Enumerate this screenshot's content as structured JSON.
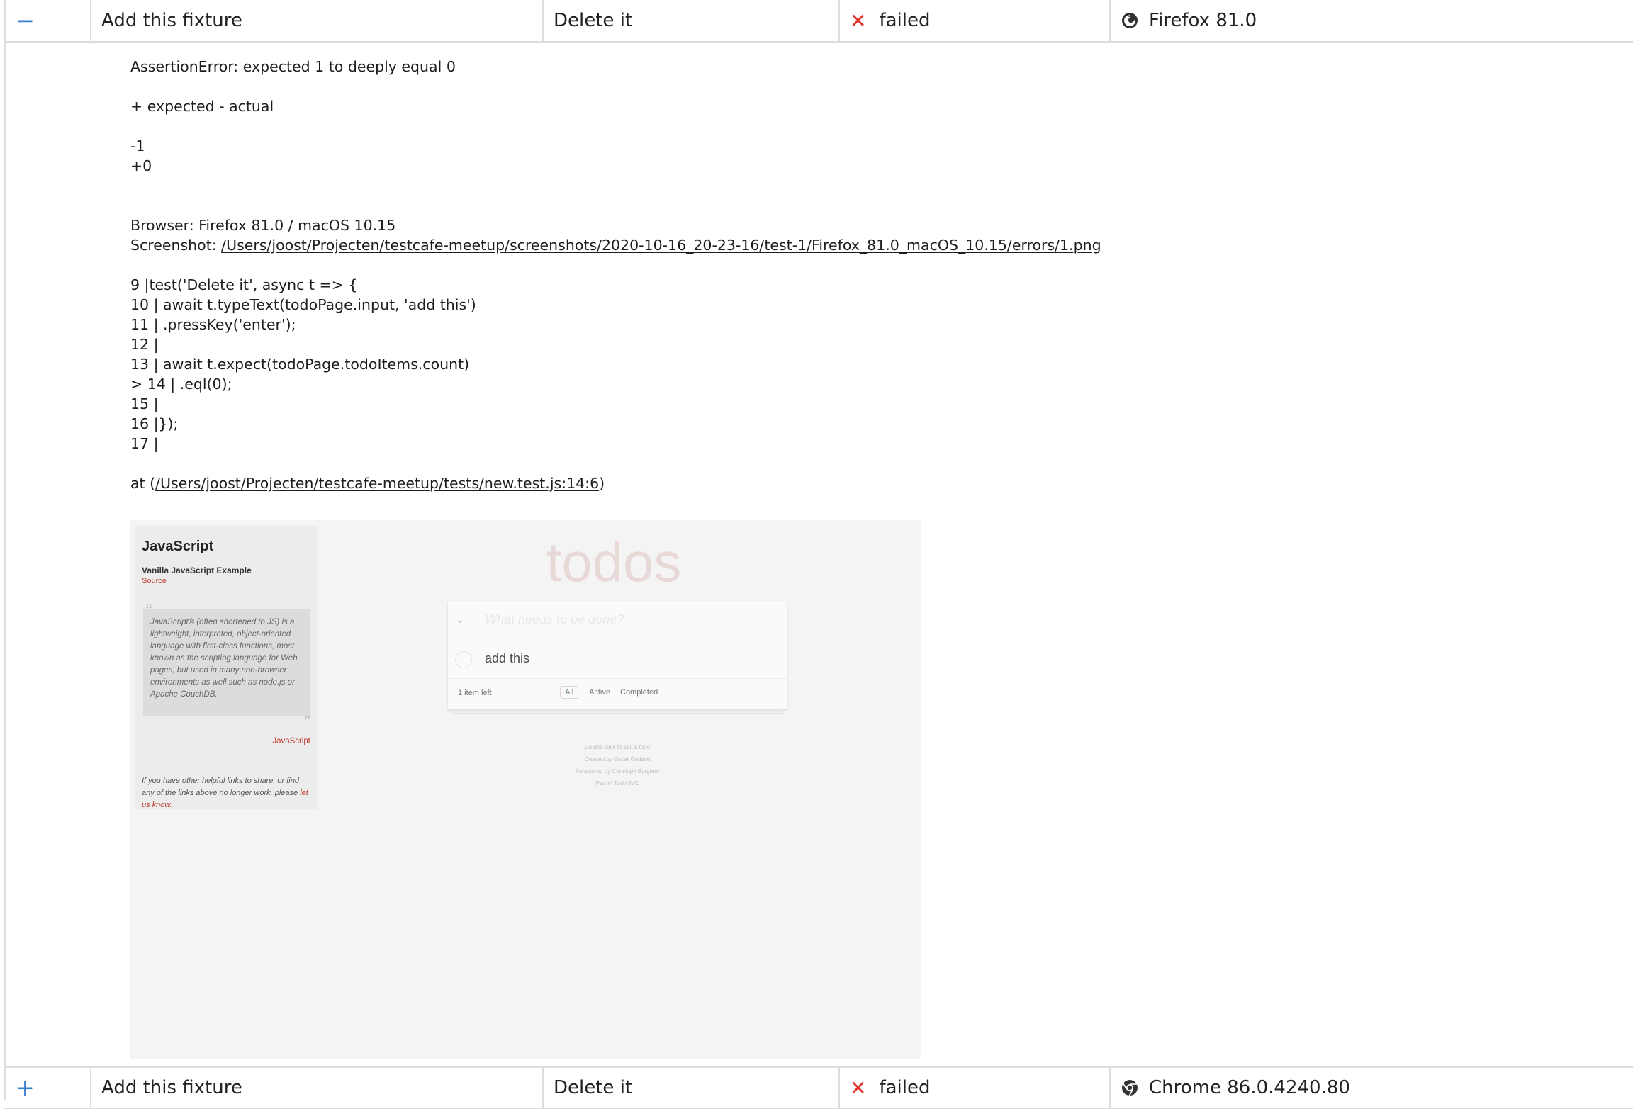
{
  "rows": [
    {
      "toggle": "−",
      "fixture": "Add this fixture",
      "test": "Delete it",
      "status_icon": "close-icon",
      "status": "failed",
      "browser_icon": "firefox-icon",
      "browser": "Firefox 81.0"
    },
    {
      "toggle": "+",
      "fixture": "Add this fixture",
      "test": "Delete it",
      "status_icon": "close-icon",
      "status": "failed",
      "browser_icon": "chrome-icon",
      "browser": "Chrome 86.0.4240.80"
    }
  ],
  "colors": {
    "accent": "#3b7fd1",
    "fail": "#e0342a",
    "border": "#dcdcdc"
  },
  "error": {
    "assertion": "AssertionError: expected 1 to deeply equal 0",
    "diff_header": "+ expected - actual",
    "diff_minus": "-1",
    "diff_plus": "+0",
    "browser_line": "Browser: Firefox 81.0 / macOS 10.15",
    "screenshot_label": "Screenshot: ",
    "screenshot_path": "/Users/joost/Projecten/testcafe-meetup/screenshots/2020-10-16_20-23-16/test-1/Firefox_81.0_macOS_10.15/errors/1.png",
    "code": [
      "9 |test('Delete it', async t => {",
      "10 | await t.typeText(todoPage.input, 'add this')",
      "11 | .pressKey('enter');",
      "12 |",
      "13 | await t.expect(todoPage.todoItems.count)",
      "> 14 | .eql(0);",
      "15 |",
      "16 |});",
      "17 |"
    ],
    "at_prefix": "at (",
    "at_path": "/Users/joost/Projecten/testcafe-meetup/tests/new.test.js:14:6",
    "at_suffix": ")"
  },
  "screenshot": {
    "sidebar": {
      "title": "JavaScript",
      "subtitle": "Vanilla JavaScript Example",
      "source": "Source",
      "quote": "JavaScript® (often shortened to JS) is a lightweight, interpreted, object-oriented language with first-class functions, most known as the scripting language for Web pages, but used in many non-browser environments as well such as node.js or Apache CouchDB.",
      "quote_cite": "JavaScript",
      "footer": "If you have other helpful links to share, or find any of the links above no longer work, please ",
      "footer_link": "let us know."
    },
    "app": {
      "title": "todos",
      "placeholder": "What needs to be done?",
      "item": "add this",
      "count": "1 item left",
      "filters": [
        "All",
        "Active",
        "Completed"
      ],
      "info": [
        "Double-click to edit a todo",
        "Created by Oscar Godson",
        "Refactored by Christoph Burgmer",
        "Part of TodoMVC"
      ]
    }
  }
}
